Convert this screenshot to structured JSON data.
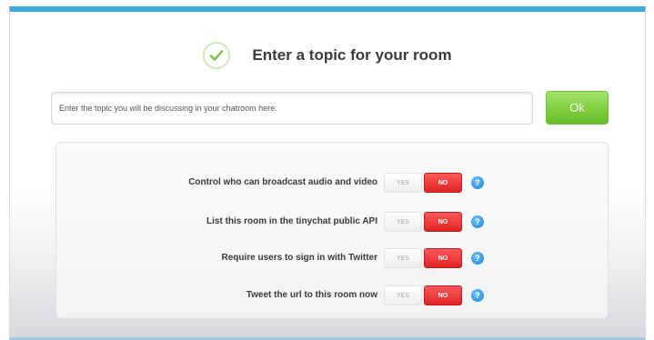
{
  "dialog": {
    "title": "Enter a topic for your room",
    "check_icon": "check-circle-icon"
  },
  "topic": {
    "placeholder": "Enter the topic you will be discussing in your chatroom here.",
    "value": ""
  },
  "ok_button": {
    "label": "Ok"
  },
  "options": [
    {
      "label": "Control who can broadcast audio and video",
      "yes_label": "YES",
      "no_label": "NO",
      "selected": "NO",
      "help_icon": "?"
    },
    {
      "label": "List this room in the tinychat public API",
      "yes_label": "YES",
      "no_label": "NO",
      "selected": "NO",
      "help_icon": "?"
    },
    {
      "label": "Require users to sign in with Twitter",
      "yes_label": "YES",
      "no_label": "NO",
      "selected": "NO",
      "help_icon": "?"
    },
    {
      "label": "Tweet the url to this room now",
      "yes_label": "YES",
      "no_label": "NO",
      "selected": "NO",
      "help_icon": "?"
    }
  ],
  "colors": {
    "accent_bar": "#3fa8de",
    "ok_green": "#7fcf3e",
    "no_red": "#e02222",
    "help_blue": "#1a7fd6"
  }
}
